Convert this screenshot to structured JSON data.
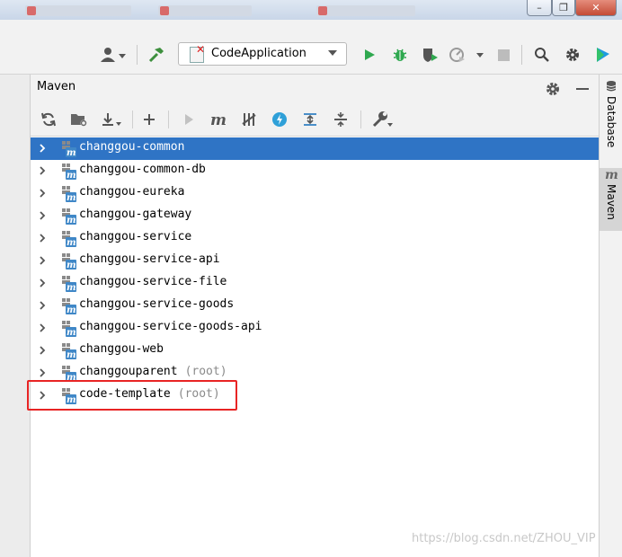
{
  "toolbar": {
    "run_config": "CodeApplication"
  },
  "maven_panel": {
    "title": "Maven",
    "projects": [
      {
        "name": "changgou-common",
        "suffix": ""
      },
      {
        "name": "changgou-common-db",
        "suffix": ""
      },
      {
        "name": "changgou-eureka",
        "suffix": ""
      },
      {
        "name": "changgou-gateway",
        "suffix": ""
      },
      {
        "name": "changgou-service",
        "suffix": ""
      },
      {
        "name": "changgou-service-api",
        "suffix": ""
      },
      {
        "name": "changgou-service-file",
        "suffix": ""
      },
      {
        "name": "changgou-service-goods",
        "suffix": ""
      },
      {
        "name": "changgou-service-goods-api",
        "suffix": ""
      },
      {
        "name": "changgou-web",
        "suffix": ""
      },
      {
        "name": "changgouparent",
        "suffix": "(root)"
      },
      {
        "name": "code-template",
        "suffix": "(root)"
      }
    ],
    "selected_index": 0
  },
  "side_tabs": {
    "database": "Database",
    "maven": "Maven"
  },
  "watermark": "https://blog.csdn.net/ZHOU_VIP",
  "colors": {
    "selection": "#2f74c5",
    "run_green": "#2fa84f",
    "highlight_red": "#e82424"
  }
}
